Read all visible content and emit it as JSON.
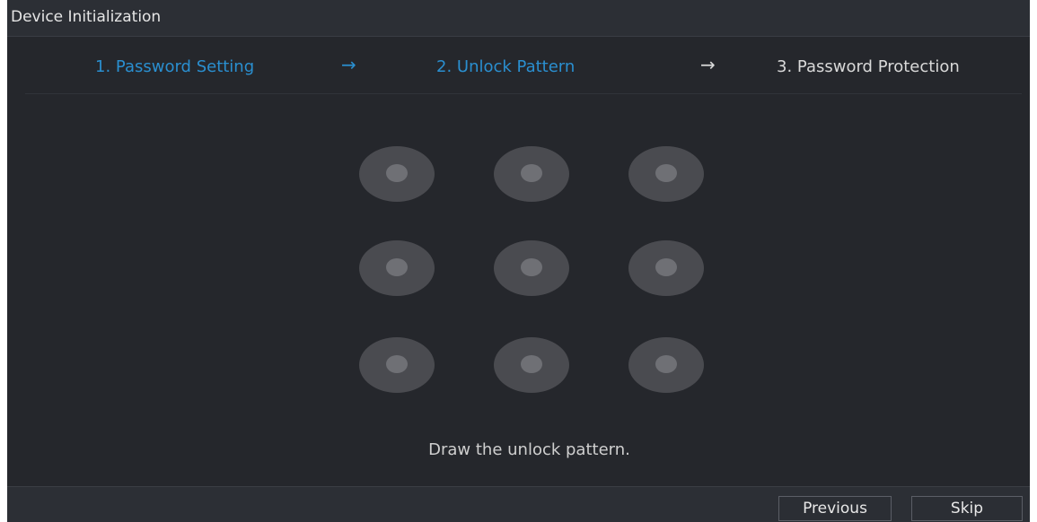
{
  "window": {
    "title": "Device Initialization"
  },
  "steps": [
    {
      "label": "1.  Password Setting",
      "state": "done"
    },
    {
      "label": "2.  Unlock Pattern",
      "state": "current"
    },
    {
      "label": "3.  Password Protection",
      "state": "pending"
    }
  ],
  "step_arrow": "→",
  "pattern": {
    "rows": 3,
    "cols": 3
  },
  "hint": "Draw the unlock pattern.",
  "footer": {
    "previous_label": "Previous",
    "skip_label": "Skip"
  },
  "colors": {
    "accent": "#2a8fd0",
    "background": "#25272c",
    "dot": "#4a4b50",
    "dot_core": "#6f7075"
  }
}
